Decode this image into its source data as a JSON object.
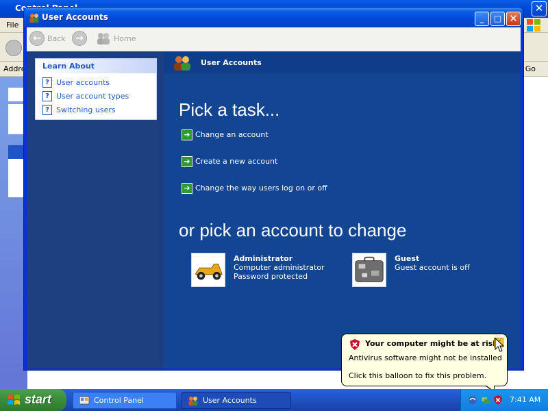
{
  "background_window": {
    "title": "Control Panel",
    "menu_file": "File",
    "address_label": "Address",
    "go_label": "Go"
  },
  "window": {
    "title": "User Accounts"
  },
  "nav": {
    "back": "Back",
    "home": "Home"
  },
  "learn_about": {
    "heading": "Learn About",
    "items": [
      {
        "label": "User accounts"
      },
      {
        "label": "User account types"
      },
      {
        "label": "Switching users"
      }
    ]
  },
  "main": {
    "header_title": "User Accounts",
    "task_heading": "Pick a task...",
    "tasks": [
      {
        "label": "Change an account"
      },
      {
        "label": "Create a new account"
      },
      {
        "label": "Change the way users log on or off"
      }
    ],
    "account_heading": "or pick an account to change",
    "accounts": [
      {
        "name": "Administrator",
        "lines": [
          "Computer administrator",
          "Password protected"
        ],
        "picture": "race-car-icon"
      },
      {
        "name": "Guest",
        "lines": [
          "Guest account is off"
        ],
        "picture": "suitcase-icon"
      }
    ]
  },
  "balloon": {
    "title": "Your computer might be at risk",
    "line1": "Antivirus software might not be installed",
    "line2": "Click this balloon to fix this problem."
  },
  "taskbar": {
    "start_label": "start",
    "buttons": [
      {
        "label": "Control Panel",
        "icon": "control-panel-icon"
      },
      {
        "label": "User Accounts",
        "icon": "user-accounts-icon"
      }
    ],
    "clock": "7:41 AM"
  }
}
